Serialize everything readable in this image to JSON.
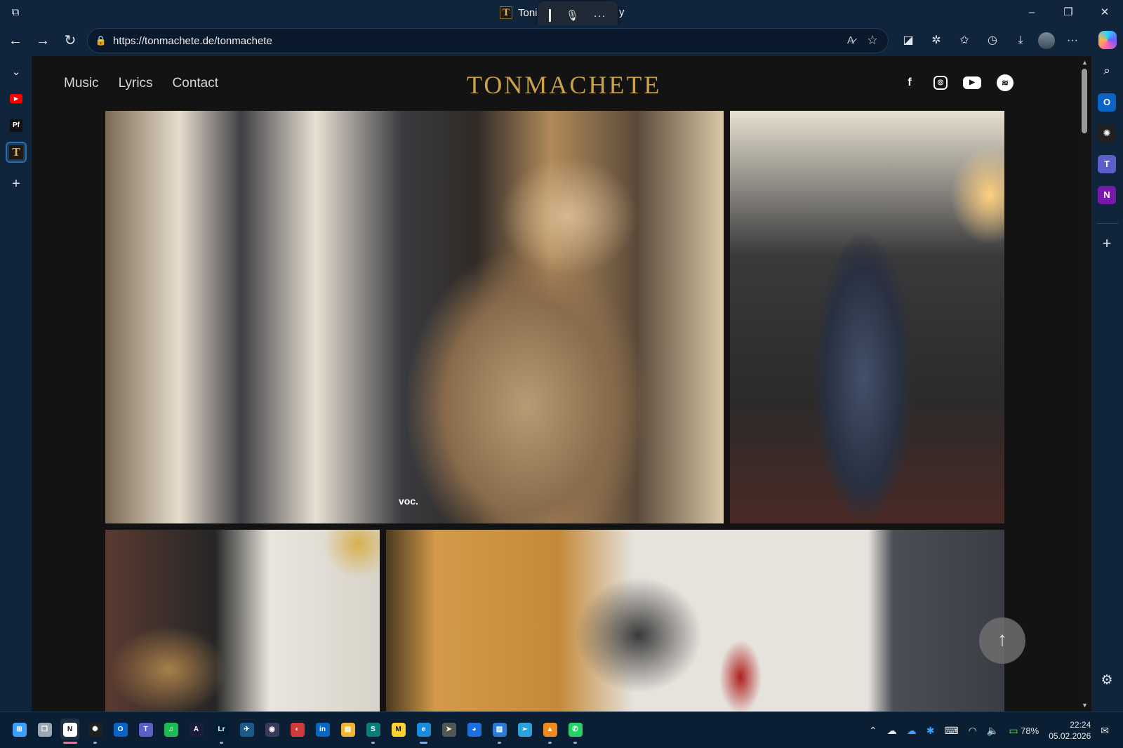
{
  "browser": {
    "tab_title": "Toni",
    "tab_favicon": "T",
    "title_suffix": "y",
    "url": "https://tonmachete.de/tonmachete",
    "window_controls": {
      "minimize": "–",
      "restore": "❐",
      "close": "✕"
    }
  },
  "dictation": {
    "more": "···"
  },
  "left_rail": {
    "tabs": [
      {
        "name": "YouTube",
        "glyph": "▶"
      },
      {
        "name": "Pf",
        "glyph": "Pf"
      },
      {
        "name": "Tonmachete",
        "glyph": "T"
      }
    ]
  },
  "right_rail": {
    "outlook": "O",
    "teams": "T",
    "onenote": "N"
  },
  "site": {
    "logo": "TONMACHETE",
    "nav": [
      "Music",
      "Lyrics",
      "Contact"
    ],
    "social": {
      "facebook": "f",
      "instagram": "◎",
      "youtube": "▶",
      "spotify": "≋"
    },
    "photos": [
      {
        "caption": "voc."
      }
    ]
  },
  "taskbar": {
    "apps": [
      {
        "name": "windows-start",
        "label": "⊞",
        "color": "#3aa0ff"
      },
      {
        "name": "task-view",
        "label": "❐",
        "color": "#9aa8b6"
      },
      {
        "name": "notion",
        "label": "N",
        "color": "#ffffff"
      },
      {
        "name": "chatgpt",
        "label": "✺",
        "color": "#202020"
      },
      {
        "name": "outlook",
        "label": "O",
        "color": "#0a64c8"
      },
      {
        "name": "teams",
        "label": "T",
        "color": "#5b5fc7"
      },
      {
        "name": "spotify",
        "label": "♫",
        "color": "#1db954"
      },
      {
        "name": "affinity",
        "label": "A",
        "color": "#1c1c3a"
      },
      {
        "name": "lightroom",
        "label": "Lr",
        "color": "#001e36"
      },
      {
        "name": "app-bird",
        "label": "✈",
        "color": "#1c5a8a"
      },
      {
        "name": "app-circle",
        "label": "◉",
        "color": "#3a3a5a"
      },
      {
        "name": "app-red",
        "label": "◐",
        "color": "#d23a3a"
      },
      {
        "name": "linkedin",
        "label": "in",
        "color": "#0a66c2"
      },
      {
        "name": "file-explorer",
        "label": "▤",
        "color": "#f2b533"
      },
      {
        "name": "sharepoint",
        "label": "S",
        "color": "#0d7d7a"
      },
      {
        "name": "miro",
        "label": "M",
        "color": "#ffd02f"
      },
      {
        "name": "edge",
        "label": "e",
        "color": "#1a8bd8"
      },
      {
        "name": "app-send",
        "label": "➤",
        "color": "#555555"
      },
      {
        "name": "app-blue",
        "label": "◕",
        "color": "#1d6fe0"
      },
      {
        "name": "app-photos",
        "label": "▨",
        "color": "#2a7ad6"
      },
      {
        "name": "telegram",
        "label": "➢",
        "color": "#2aa3df"
      },
      {
        "name": "vlc",
        "label": "▲",
        "color": "#f08a1c"
      },
      {
        "name": "whatsapp",
        "label": "✆",
        "color": "#25d366"
      }
    ],
    "battery": "78%",
    "time": "22:24",
    "date": "05.02.2026"
  }
}
